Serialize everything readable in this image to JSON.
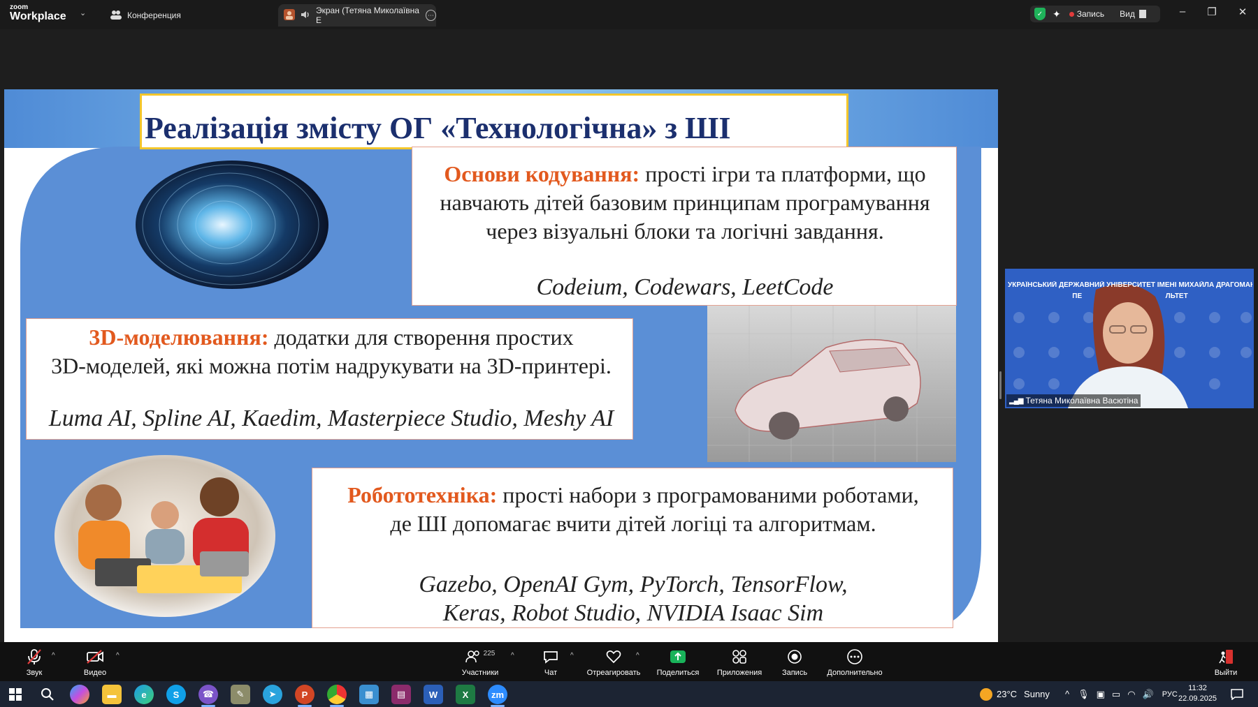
{
  "titlebar": {
    "logo_line1": "zoom",
    "logo_line2": "Workplace",
    "tabs": [
      {
        "label": "Конференция"
      },
      {
        "label": "Экран (Тетяна Миколаївна Е"
      }
    ],
    "record_label": "Запись",
    "view_label": "Вид"
  },
  "slide": {
    "title": "Реалізація змісту ОГ «Технологічна» з ШІ",
    "coding": {
      "heading": "Основи кодування:",
      "text_1": " прості ігри та платформи, що",
      "text_2": "навчають дітей базовим принципам програмування",
      "text_3": "через візуальні блоки та логічні завдання.",
      "tools": "Codeium, Codewars, LeetCode"
    },
    "modeling": {
      "heading": "3D-моделювання:",
      "text_1": " додатки для створення простих",
      "text_2": "3D-моделей, які можна потім надрукувати на 3D-принтері.",
      "tools": "Luma AI, Spline AI, Kaedim, Masterpiece Studio, Meshy AI"
    },
    "robotics": {
      "heading": "Робототехніка:",
      "text_1": " прості набори з програмованими роботами,",
      "text_2": "де ШІ допомагає вчити дітей логіці та алгоритмам.",
      "tools_1": "Gazebo, OpenAI Gym, PyTorch, TensorFlow,",
      "tools_2": "Keras, Robot Studio, NVIDIA Isaac Sim"
    }
  },
  "webcam": {
    "banner_1": "УКРАЇНСЬКИЙ ДЕРЖАВНИЙ УНІВЕРСИТЕТ ІМЕНІ МИХАЙЛА ДРАГОМАНОВА",
    "banner_2": "ПЕ                                           ЛЬТЕТ",
    "participant_name": "Тетяна Миколаївна Васютіна"
  },
  "toolbar": {
    "audio": "Звук",
    "video": "Видео",
    "participants": "Участники",
    "participants_count": "225",
    "chat": "Чат",
    "react": "Отреагировать",
    "share": "Поделиться",
    "apps": "Приложения",
    "record": "Запись",
    "more": "Дополнительно",
    "leave": "Выйти"
  },
  "taskbar": {
    "weather_temp": "23°C",
    "weather_text": "Sunny",
    "lang": "РУС",
    "time": "11:32",
    "date": "22.09.2025",
    "apps": [
      "Пуск",
      "Поиск",
      "Copilot",
      "Проводник",
      "Edge",
      "Skype",
      "Viber",
      "Утилита",
      "Telegram",
      "PowerPoint",
      "Chrome",
      "Фото",
      "WinRAR",
      "Word",
      "Excel",
      "Zoom"
    ]
  },
  "colors": {
    "slide_blue": "#5b8fd6",
    "heading_orange": "#e2591e",
    "title_navy": "#1b2f6e",
    "title_border": "#f3c62b",
    "share_green": "#19b35a"
  }
}
